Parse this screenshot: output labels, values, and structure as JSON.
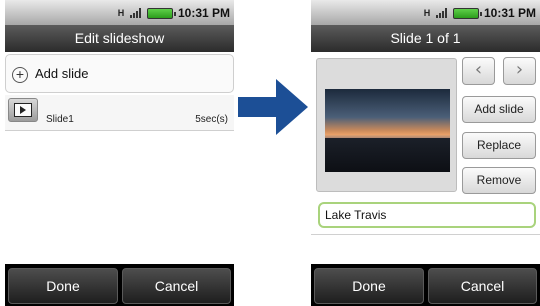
{
  "left_screen": {
    "status_time": "10:31 PM",
    "title": "Edit slideshow",
    "add_slide_label": "Add slide",
    "slides": [
      {
        "name": "Slide1",
        "duration": "5sec(s)"
      }
    ],
    "bottom_buttons": {
      "done": "Done",
      "cancel": "Cancel"
    }
  },
  "right_screen": {
    "status_time": "10:31 PM",
    "title": "Slide 1 of 1",
    "buttons": {
      "add_slide": "Add slide",
      "replace": "Replace",
      "remove": "Remove"
    },
    "nav": {
      "prev_glyph": "‹",
      "next_glyph": "›"
    },
    "caption_value": "Lake Travis",
    "bottom_buttons": {
      "done": "Done",
      "cancel": "Cancel"
    }
  },
  "colors": {
    "arrow": "#1c4f96",
    "caption_border": "#a9d37c",
    "battery": "#3cb228"
  },
  "icons": [
    "network-h-icon",
    "signal-icon",
    "battery-icon",
    "plus-icon",
    "slideshow-icon",
    "arrow-right-icon"
  ]
}
